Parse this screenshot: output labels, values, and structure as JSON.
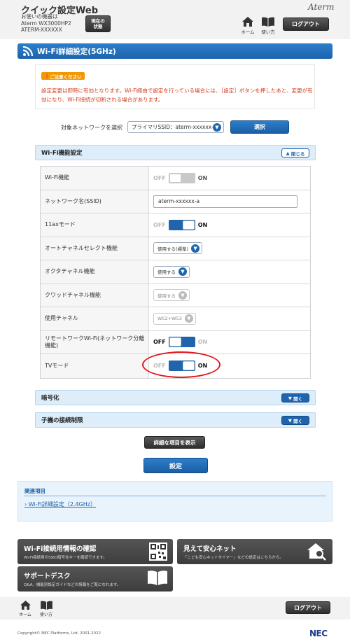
{
  "header": {
    "app_title": "クイック設定Web",
    "device_line1": "お使いの機器は",
    "device_line2": "Aterm WX3000HP2",
    "device_line3": "ATERM-XXXXXX",
    "status_button_line1": "現在の",
    "status_button_line2": "状態",
    "brand": "Aterm",
    "nav_home": "ホーム",
    "nav_manual": "使い方",
    "logout": "ログアウト"
  },
  "page_title": "Wi-Fi詳細設定(5GHz)",
  "caution": {
    "badge": "ご注意ください",
    "text": "設定変更は即時に有効となります。Wi-Fi経由で設定を行っている場合には、［設定］ボタンを押したあと、変更が有効になり、Wi-Fi接続が切断される場合があります。"
  },
  "network_select": {
    "label": "対象ネットワークを選択",
    "value": "プライマリSSID：aterm-xxxxxx-a",
    "button": "選択"
  },
  "wifi_section": {
    "title": "Wi-Fi機能設定",
    "toggle": "閉じる",
    "rows": [
      {
        "label": "Wi-Fi機能",
        "off": "OFF",
        "on": "ON"
      },
      {
        "label": "ネットワーク名(SSID)",
        "value": "aterm-xxxxxx-a"
      },
      {
        "label": "11axモード",
        "off": "OFF",
        "on": "ON"
      },
      {
        "label": "オートチャネルセレクト機能",
        "value": "使用する(標準)"
      },
      {
        "label": "オクタチャネル機能",
        "value": "使用する"
      },
      {
        "label": "クワッドチャネル機能",
        "value": "使用する"
      },
      {
        "label": "使用チャネル",
        "value": "W52+W53"
      },
      {
        "label": "リモートワークWi-Fi(ネットワーク分離機能)",
        "off": "OFF",
        "on": "ON"
      },
      {
        "label": "TVモード",
        "off": "OFF",
        "on": "ON"
      }
    ]
  },
  "encryption_section": {
    "title": "暗号化",
    "toggle": "開く"
  },
  "restriction_section": {
    "title": "子機の接続制限",
    "toggle": "開く"
  },
  "buttons": {
    "show_details": "詳細な項目を表示",
    "apply": "設定"
  },
  "related": {
    "title": "関連項目",
    "link": "Wi-Fi詳細設定（2.4GHz）"
  },
  "cards": {
    "wifi_info_title": "Wi-Fi接続用情報の確認",
    "wifi_info_desc": "Wi-Fi接続用のSSID暗号化キーを確認できます。",
    "safety_title": "見えて安心ネット",
    "safety_desc": "「こども安心ネットタイマー」などの設定はこちらから。",
    "support_title": "サポートデスク",
    "support_desc": "Q&A、機能別設定ガイドなどの情報をご覧になれます。"
  },
  "footer": {
    "nav_home": "ホーム",
    "nav_manual": "使い方",
    "logout": "ログアウト",
    "copyright": "Copyright© NEC Platforms, Ltd. 2001-2022",
    "brand": "NEC"
  },
  "colors": {
    "primary": "#1f64ad",
    "caution": "#f39800",
    "warning_text": "#d23c1e",
    "highlight": "#e0161b"
  }
}
